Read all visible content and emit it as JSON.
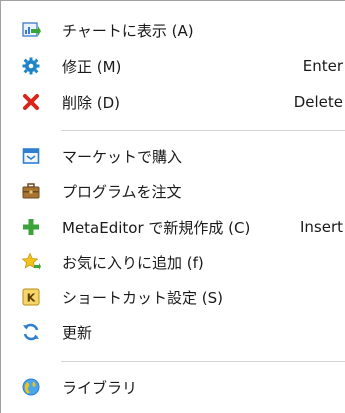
{
  "menu": {
    "items": [
      {
        "label": "チャートに表示 (A)",
        "shortcut": "",
        "icon": "chart-show-icon"
      },
      {
        "label": "修正 (M)",
        "shortcut": "Enter",
        "icon": "modify-gear-icon"
      },
      {
        "label": "削除 (D)",
        "shortcut": "Delete",
        "icon": "delete-x-icon"
      },
      {
        "label": "マーケットで購入",
        "shortcut": "",
        "icon": "market-icon"
      },
      {
        "label": "プログラムを注文",
        "shortcut": "",
        "icon": "briefcase-icon"
      },
      {
        "label": "MetaEditor で新規作成 (C)",
        "shortcut": "Insert",
        "icon": "plus-icon"
      },
      {
        "label": "お気に入りに追加 (f)",
        "shortcut": "",
        "icon": "star-add-icon"
      },
      {
        "label": "ショートカット設定 (S)",
        "shortcut": "",
        "icon": "hotkey-k-icon"
      },
      {
        "label": "更新",
        "shortcut": "",
        "icon": "refresh-icon"
      },
      {
        "label": "ライブラリ",
        "shortcut": "",
        "icon": "globe-library-icon"
      }
    ]
  },
  "colors": {
    "delete_red": "#d9261c",
    "plus_green": "#3aa33a",
    "gear_blue": "#1e86c8",
    "star_yellow": "#f2c21b",
    "separator": "#d4d4d4"
  }
}
